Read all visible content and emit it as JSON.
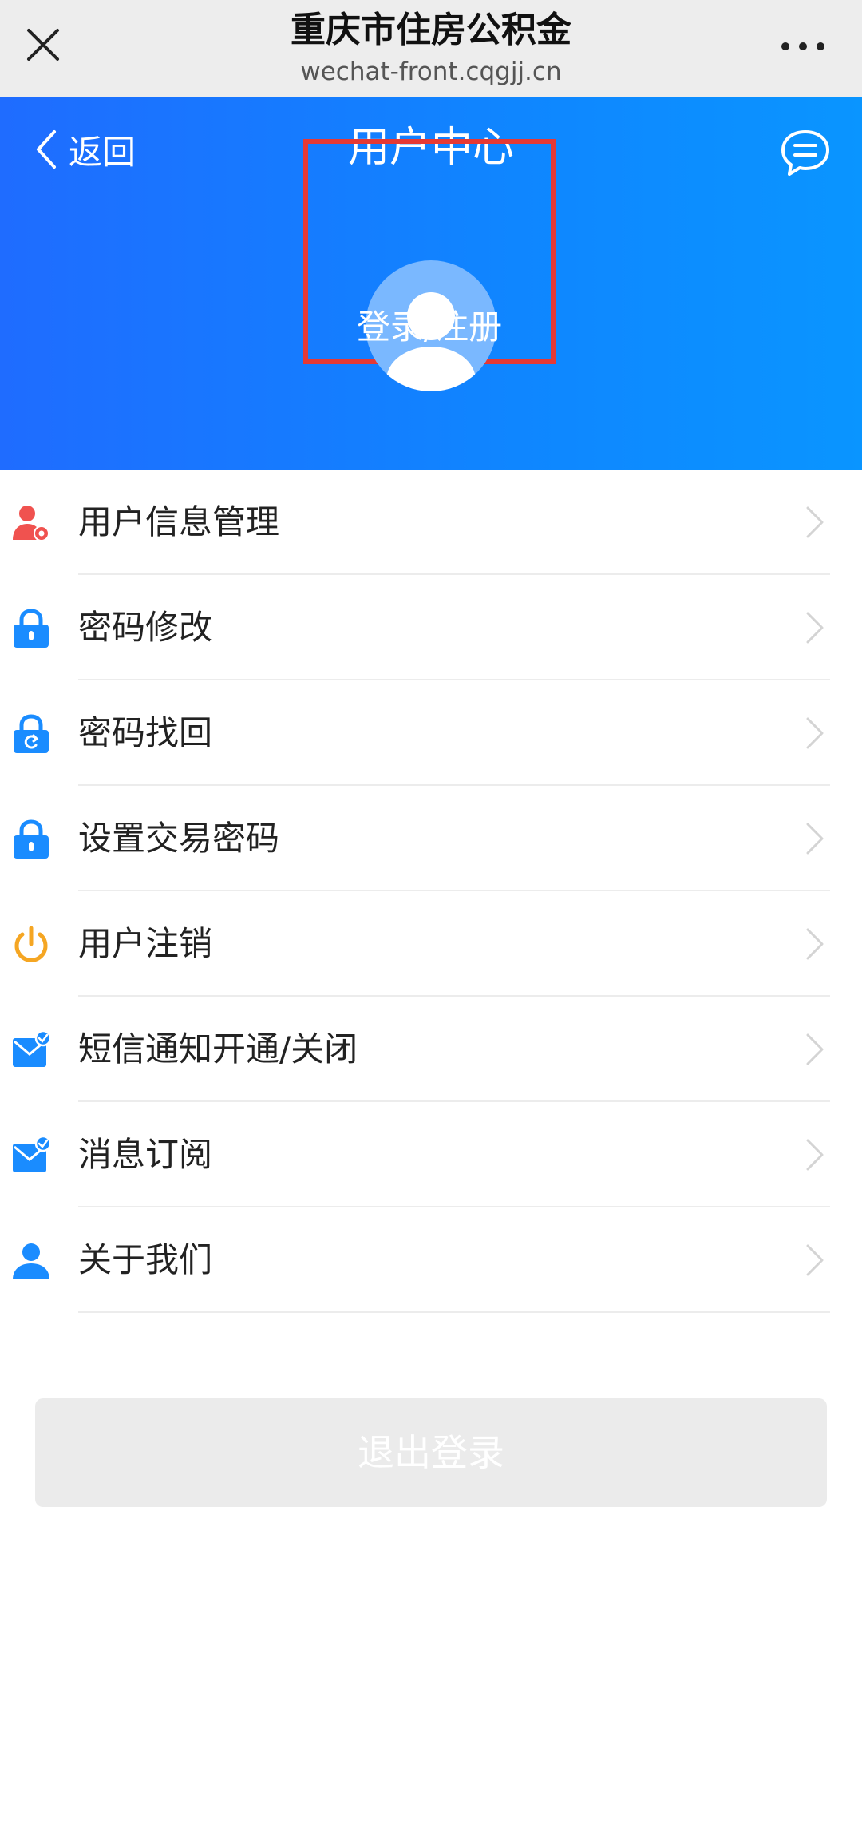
{
  "wechat_bar": {
    "title": "重庆市住房公积金",
    "subtitle": "wechat-front.cqgjj.cn"
  },
  "header": {
    "back_label": "返回",
    "title": "用户中心",
    "login_label": "登录/注册"
  },
  "menu": [
    {
      "label": "用户信息管理",
      "icon": "user-settings-icon"
    },
    {
      "label": "密码修改",
      "icon": "lock-icon"
    },
    {
      "label": "密码找回",
      "icon": "lock-refresh-icon"
    },
    {
      "label": "设置交易密码",
      "icon": "lock-icon"
    },
    {
      "label": "用户注销",
      "icon": "power-icon"
    },
    {
      "label": "短信通知开通/关闭",
      "icon": "mail-check-icon"
    },
    {
      "label": "消息订阅",
      "icon": "mail-check-icon"
    },
    {
      "label": "关于我们",
      "icon": "person-icon"
    }
  ],
  "logout_label": "退出登录",
  "colors": {
    "header_blue": "#1f6cff",
    "icon_blue": "#1a8cff",
    "icon_red": "#f0524f",
    "icon_orange": "#f5a623",
    "highlight_red": "#e53935"
  }
}
